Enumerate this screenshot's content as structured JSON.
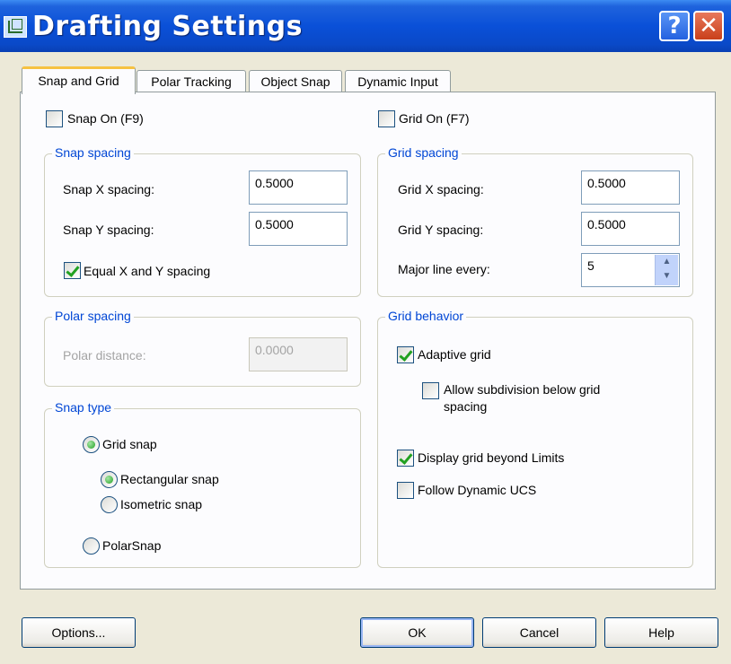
{
  "window": {
    "title": "Drafting Settings"
  },
  "tabs": [
    {
      "label": "Snap and Grid",
      "active": true
    },
    {
      "label": "Polar Tracking",
      "active": false
    },
    {
      "label": "Object Snap",
      "active": false
    },
    {
      "label": "Dynamic Input",
      "active": false
    }
  ],
  "snap": {
    "snap_on_label": "Snap On (F9)",
    "snap_on_checked": false,
    "spacing_legend": "Snap spacing",
    "x_label": "Snap X spacing:",
    "x_value": "0.5000",
    "y_label": "Snap Y spacing:",
    "y_value": "0.5000",
    "equal_label": "Equal X and Y spacing",
    "equal_checked": true
  },
  "polar": {
    "legend": "Polar spacing",
    "distance_label": "Polar distance:",
    "distance_value": "0.0000"
  },
  "snap_type": {
    "legend": "Snap type",
    "grid_snap": "Grid snap",
    "rectangular": "Rectangular snap",
    "isometric": "Isometric snap",
    "polarsnap": "PolarSnap",
    "selected_type": "Grid snap",
    "selected_style": "Rectangular snap"
  },
  "grid": {
    "grid_on_label": "Grid On (F7)",
    "grid_on_checked": false,
    "spacing_legend": "Grid spacing",
    "x_label": "Grid X spacing:",
    "x_value": "0.5000",
    "y_label": "Grid Y spacing:",
    "y_value": "0.5000",
    "major_label": "Major line every:",
    "major_value": "5"
  },
  "grid_behavior": {
    "legend": "Grid behavior",
    "adaptive": "Adaptive grid",
    "adaptive_checked": true,
    "subdivision_line1": "Allow subdivision below grid",
    "subdivision_line2": "spacing",
    "subdivision_checked": false,
    "beyond_limits": "Display grid beyond Limits",
    "beyond_limits_checked": true,
    "follow_ucs": "Follow Dynamic UCS",
    "follow_ucs_checked": false
  },
  "buttons": {
    "options": "Options...",
    "ok": "OK",
    "cancel": "Cancel",
    "help": "Help"
  },
  "colors": {
    "title_bar": "#0a50d8",
    "legend_text": "#0046d5",
    "dialog_bg": "#ece9d8",
    "check_green": "#21a121"
  }
}
